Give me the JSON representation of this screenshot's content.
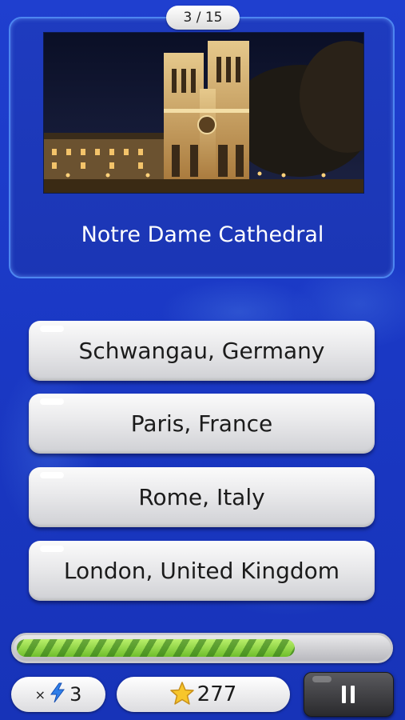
{
  "quiz": {
    "counter": "3 / 15",
    "question": "Notre Dame Cathedral",
    "answers": [
      "Schwangau, Germany",
      "Paris, France",
      "Rome, Italy",
      "London, United Kingdom"
    ],
    "progress_fraction": 0.75
  },
  "status": {
    "hint_prefix": "×",
    "hint_count": "3",
    "hint_icon": "lightning-icon",
    "score": "277",
    "score_icon": "star-icon",
    "pause_icon": "pause-icon"
  },
  "colors": {
    "background": "#1a38c4",
    "card_border": "#4d86f0",
    "progress_green": "#8fd84a",
    "star_gold": "#f7c62b",
    "lightning_blue": "#2f7ee8"
  }
}
